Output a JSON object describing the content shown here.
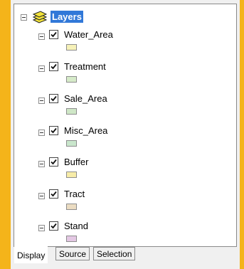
{
  "toc": {
    "root_label": "Layers",
    "layers": [
      {
        "label": "Water_Area",
        "checked": true,
        "swatch_color": "#f6f1b8"
      },
      {
        "label": "Treatment",
        "checked": true,
        "swatch_color": "#d6ebc9"
      },
      {
        "label": "Sale_Area",
        "checked": true,
        "swatch_color": "#cfe7c7"
      },
      {
        "label": "Misc_Area",
        "checked": true,
        "swatch_color": "#c9e6cc"
      },
      {
        "label": "Buffer",
        "checked": true,
        "swatch_color": "#f7eca8"
      },
      {
        "label": "Tract",
        "checked": true,
        "swatch_color": "#ebdcc2"
      },
      {
        "label": "Stand",
        "checked": true,
        "swatch_color": "#e4c8e4"
      }
    ]
  },
  "tabs": [
    {
      "label": "Display",
      "active": true
    },
    {
      "label": "Source",
      "active": false
    },
    {
      "label": "Selection",
      "active": false
    }
  ],
  "colors": {
    "background": "#f4b41a",
    "selection": "#3178d8"
  }
}
